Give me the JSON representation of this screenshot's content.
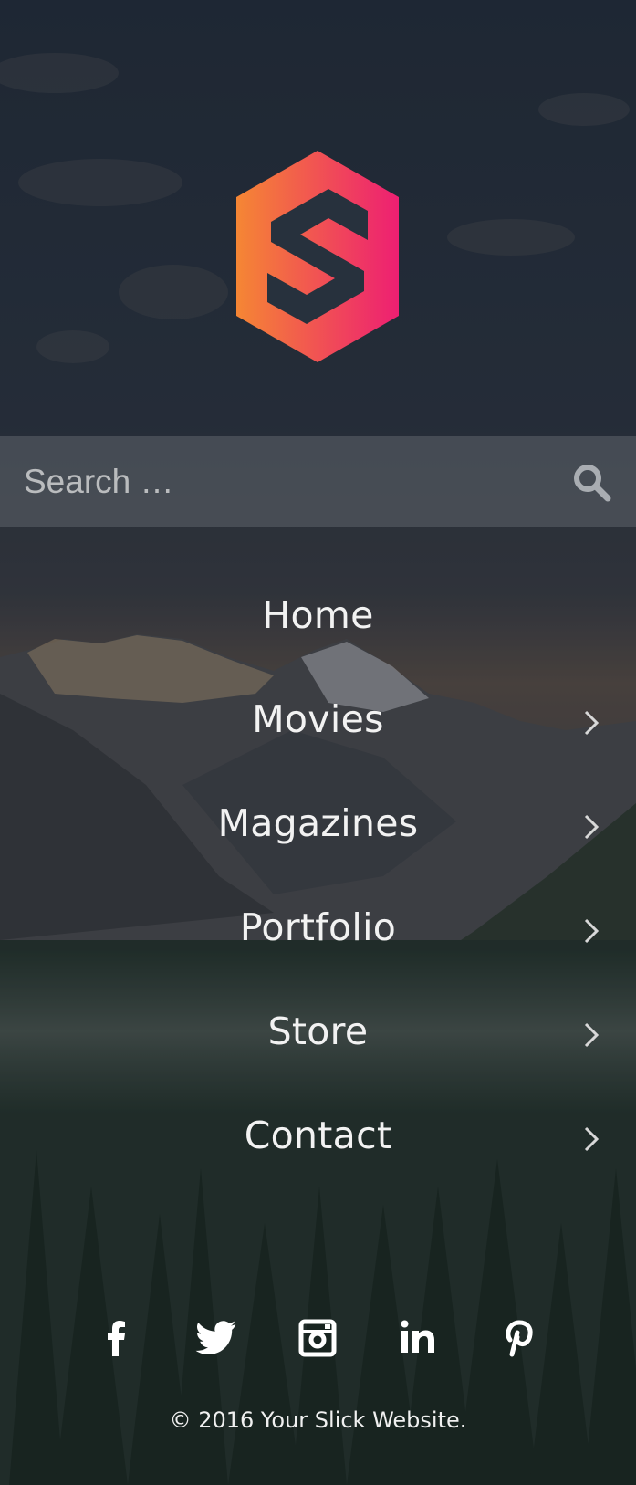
{
  "search": {
    "placeholder": "Search …"
  },
  "nav": {
    "items": [
      {
        "label": "Home",
        "has_submenu": false
      },
      {
        "label": "Movies",
        "has_submenu": true
      },
      {
        "label": "Magazines",
        "has_submenu": true
      },
      {
        "label": "Portfolio",
        "has_submenu": true
      },
      {
        "label": "Store",
        "has_submenu": true
      },
      {
        "label": "Contact",
        "has_submenu": true
      }
    ]
  },
  "social": [
    "facebook-icon",
    "twitter-icon",
    "instagram-icon",
    "linkedin-icon",
    "pinterest-icon"
  ],
  "footer": {
    "copyright": "© 2016 Your Slick Website."
  },
  "colors": {
    "logo_gradient_start": "#f58634",
    "logo_gradient_end": "#ed1f72",
    "text": "#f2f2f2",
    "search_bar": "#5f646c"
  }
}
